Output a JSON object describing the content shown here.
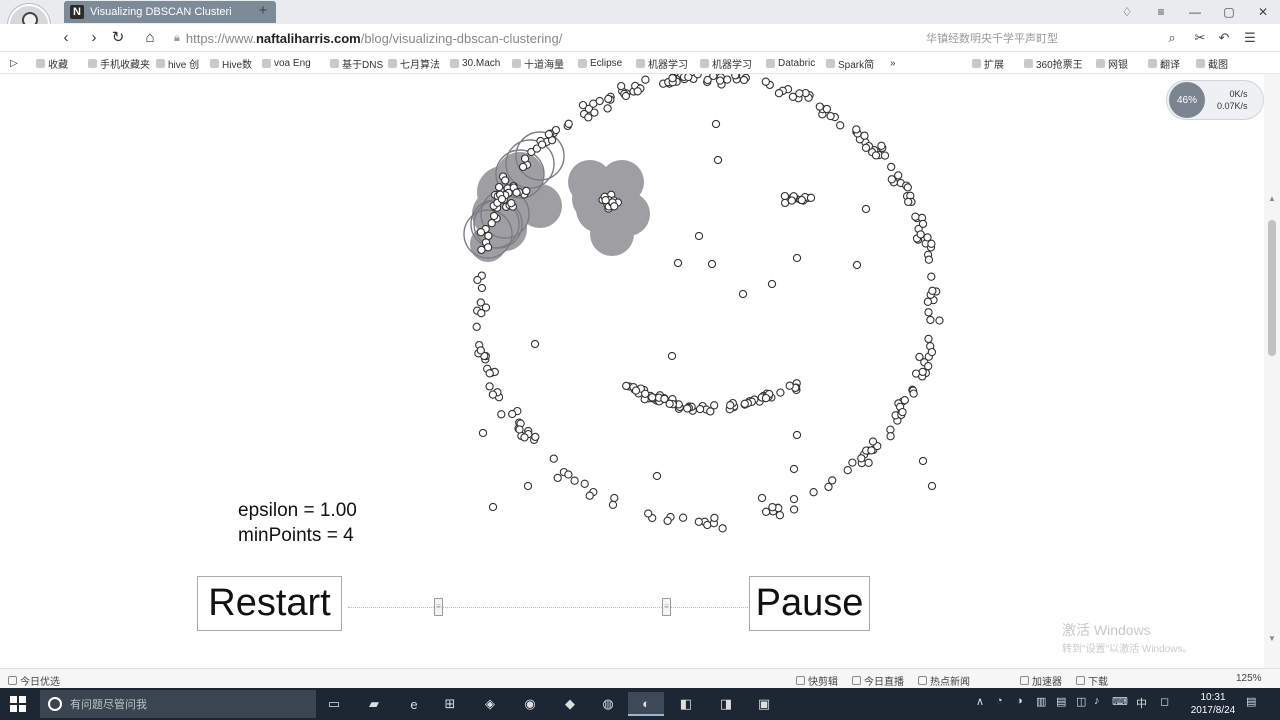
{
  "browser": {
    "tab_title": "Visualizing DBSCAN Clusteri",
    "tab_favicon": "N",
    "new_tab": "+",
    "url_prefix": "https://www.",
    "url_domain": "naftaliharris.com",
    "url_path": "/blog/visualizing-dbscan-clustering/",
    "nav_right_text": "华镇经数明央千学平声町型",
    "bookmarks": [
      "收藏",
      "手机收藏夹",
      "hive 创",
      "Hive数",
      "voa Eng",
      "基于DNS",
      "七月算法",
      "30.Mach",
      "十道海量",
      "Eclipse",
      "机器学习",
      "机器学习",
      "Databric",
      "Spark简",
      "»",
      "扩展",
      "360抢票王",
      "网银",
      "翻译",
      "截图"
    ],
    "net_widget": {
      "percent": "46%",
      "up": "0K/s",
      "down": "0.07K/s"
    }
  },
  "page": {
    "epsilon_label": "epsilon = 1.00",
    "minpoints_label": "minPoints = 4",
    "restart_label": "Restart",
    "pause_label": "Pause",
    "watermark_title": "激活 Windows",
    "watermark_sub": "转到\"设置\"以激活 Windows。"
  },
  "statusbar": {
    "left": "今日优选",
    "items": [
      "快剪辑",
      "今日直播",
      "热点新闻",
      "加速器",
      "下载",
      "125%"
    ]
  },
  "taskbar": {
    "search_placeholder": "有问题尽管问我",
    "clock_time": "10:31",
    "clock_date": "2017/8/24",
    "ime": "中"
  },
  "colors": {
    "cluster_fill": "#9e9ea3",
    "point_stroke": "#333333",
    "epsilon_ring": "#7c7c82"
  },
  "chart_data": {
    "type": "scatter",
    "title": "",
    "description_visible": "DBSCAN smiley-face dataset; two clusters partially expanded on the upper-left eye region",
    "epsilon": 1.0,
    "minPoints": 4
  }
}
